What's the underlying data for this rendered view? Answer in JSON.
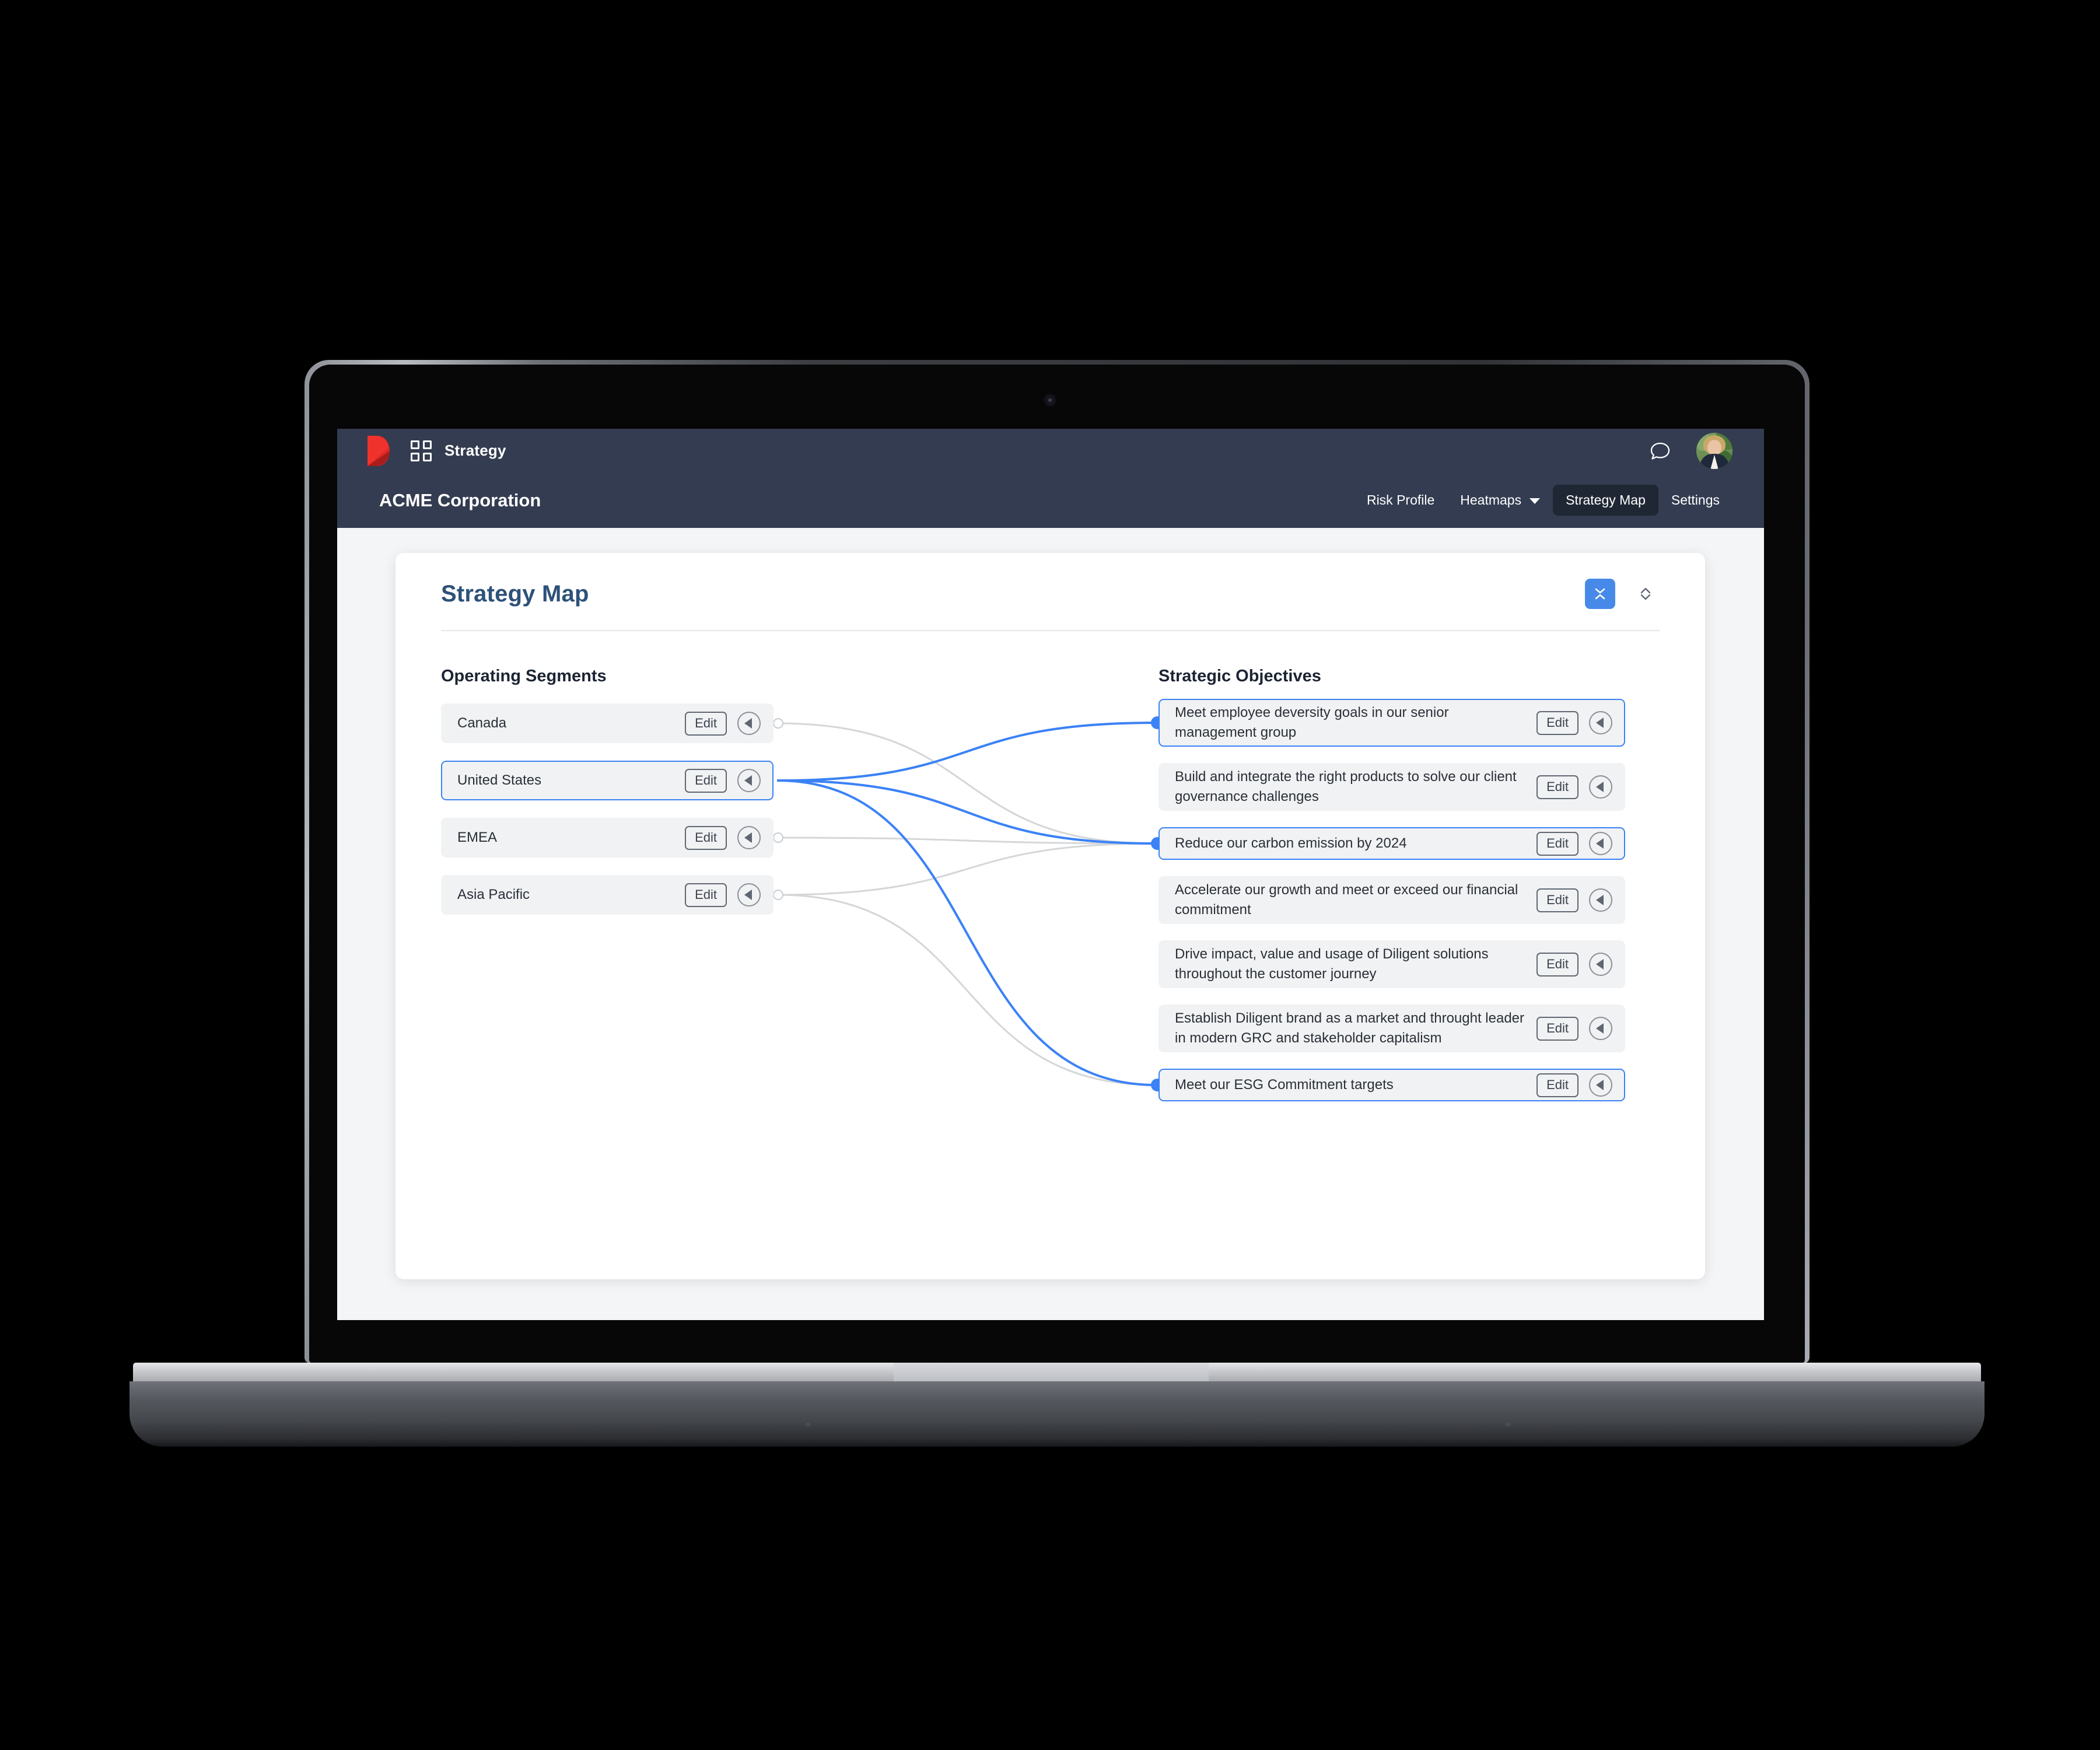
{
  "app": {
    "logo_icon": "diligent-logo-icon",
    "apps_icon": "grid-apps-icon",
    "product_name": "Strategy",
    "chat_icon": "chat-bubble-icon",
    "avatar_icon": "user-avatar"
  },
  "org": {
    "name": "ACME Corporation"
  },
  "nav": {
    "items": [
      {
        "label": "Risk Profile",
        "active": false,
        "has_dropdown": false
      },
      {
        "label": "Heatmaps",
        "active": false,
        "has_dropdown": true
      },
      {
        "label": "Strategy Map",
        "active": true,
        "has_dropdown": false
      },
      {
        "label": "Settings",
        "active": false,
        "has_dropdown": false
      }
    ]
  },
  "card": {
    "title": "Strategy Map",
    "collapse_icon": "collapse-vertical-icon",
    "expand_icon": "expand-vertical-icon"
  },
  "segments": {
    "heading": "Operating Segments",
    "edit_label": "Edit",
    "play_icon": "play-left-icon",
    "items": [
      {
        "label": "Canada",
        "selected": false
      },
      {
        "label": "United States",
        "selected": true
      },
      {
        "label": "EMEA",
        "selected": false
      },
      {
        "label": "Asia Pacific",
        "selected": false
      }
    ]
  },
  "objectives": {
    "heading": "Strategic Objectives",
    "edit_label": "Edit",
    "play_icon": "play-left-icon",
    "items": [
      {
        "label": "Meet employee deversity goals in our senior management group",
        "selected": true
      },
      {
        "label": "Build and integrate the right products to solve our client governance challenges",
        "selected": false
      },
      {
        "label": "Reduce our carbon emission by 2024",
        "selected": true
      },
      {
        "label": "Accelerate our growth and meet or exceed our financial commitment",
        "selected": false
      },
      {
        "label": "Drive impact, value and usage of Diligent solutions throughout the customer journey",
        "selected": false
      },
      {
        "label": "Establish Diligent brand as a market and throught leader in modern GRC and stakeholder capitalism",
        "selected": false
      },
      {
        "label": "Meet our ESG Commitment targets",
        "selected": true
      }
    ]
  },
  "links": [
    {
      "from": 0,
      "to": 2,
      "highlighted": false
    },
    {
      "from": 1,
      "to": 0,
      "highlighted": true
    },
    {
      "from": 1,
      "to": 2,
      "highlighted": true
    },
    {
      "from": 1,
      "to": 6,
      "highlighted": true
    },
    {
      "from": 2,
      "to": 2,
      "highlighted": false
    },
    {
      "from": 3,
      "to": 2,
      "highlighted": false
    },
    {
      "from": 3,
      "to": 6,
      "highlighted": false
    }
  ],
  "colors": {
    "brand_red": "#e02826",
    "nav_bg": "#333c50",
    "nav_active_bg": "#1f2734",
    "accent_blue": "#3b82f6",
    "title_blue": "#2d5179",
    "node_bg": "#f1f2f3",
    "link_gray": "#d4d6d8"
  }
}
